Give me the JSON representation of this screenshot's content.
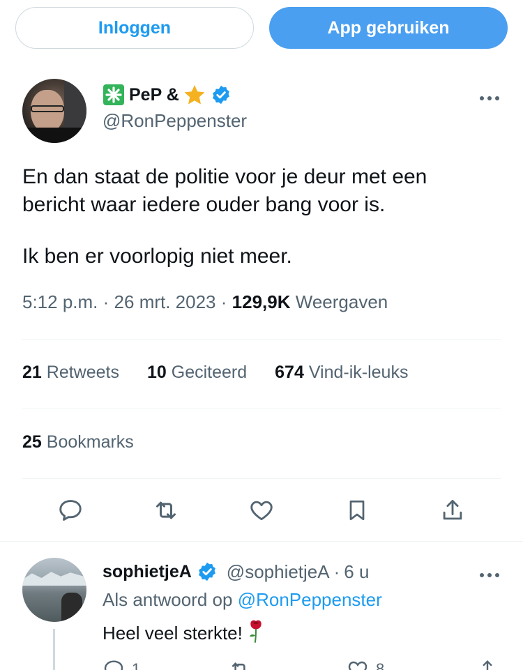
{
  "top_buttons": {
    "login": "Inloggen",
    "app": "App gebruiken"
  },
  "colors": {
    "accent": "#1d9bf0",
    "app_button": "#4a9ff0",
    "muted": "#536471",
    "text": "#0f1419",
    "verified": "#1d9bf0",
    "star": "#f4b120",
    "clover": "#33b35a"
  },
  "tweet": {
    "display_name": "PeP &",
    "name_emojis": [
      "eight-spoked-asterisk-icon",
      "star-icon",
      "verified-badge-icon"
    ],
    "handle": "@RonPeppenster",
    "text_lines": [
      "En dan staat de politie voor je deur met een",
      "bericht waar iedere ouder bang voor is."
    ],
    "text_line_2": "Ik ben er voorlopig niet meer.",
    "time": "5:12 p.m.",
    "date": "26 mrt. 2023",
    "views_count": "129,9K",
    "views_label": "Weergaven",
    "separator": "·"
  },
  "stats": {
    "retweets_count": "21",
    "retweets_label": "Retweets",
    "quotes_count": "10",
    "quotes_label": "Geciteerd",
    "likes_count": "674",
    "likes_label": "Vind-ik-leuks",
    "bookmarks_count": "25",
    "bookmarks_label": "Bookmarks"
  },
  "actions": [
    "reply-icon",
    "retweet-icon",
    "like-icon",
    "bookmark-icon",
    "share-icon"
  ],
  "reply": {
    "display_name": "sophietjeA",
    "handle": "@sophietjeA",
    "time": "6 u",
    "separator": "·",
    "reply_to_prefix": "Als antwoord op",
    "reply_to_handle": "@RonPeppenster",
    "text": "Heel veel sterkte!",
    "text_emoji": "rose-icon",
    "reply_count": "1",
    "like_count": "8"
  }
}
